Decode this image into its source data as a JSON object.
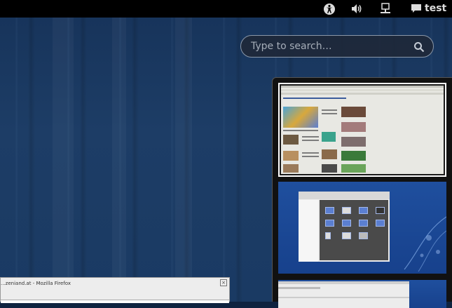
{
  "topbar": {
    "indicators": [
      "accessibility-icon",
      "volume-icon",
      "network-icon",
      "chat-icon"
    ],
    "user_name": "test"
  },
  "search": {
    "placeholder": "Type to search…"
  },
  "workspaces": [
    {
      "name": "workspace-1",
      "active": true
    },
    {
      "name": "workspace-2",
      "active": false
    },
    {
      "name": "workspace-3",
      "active": false
    }
  ],
  "window": {
    "title": "...zeniand.at - Mozilla Firefox",
    "close_glyph": "×"
  },
  "colors": {
    "desktop": "#1a3a63",
    "topbar": "#000000",
    "workspace_bg": "#1f4f9e"
  }
}
